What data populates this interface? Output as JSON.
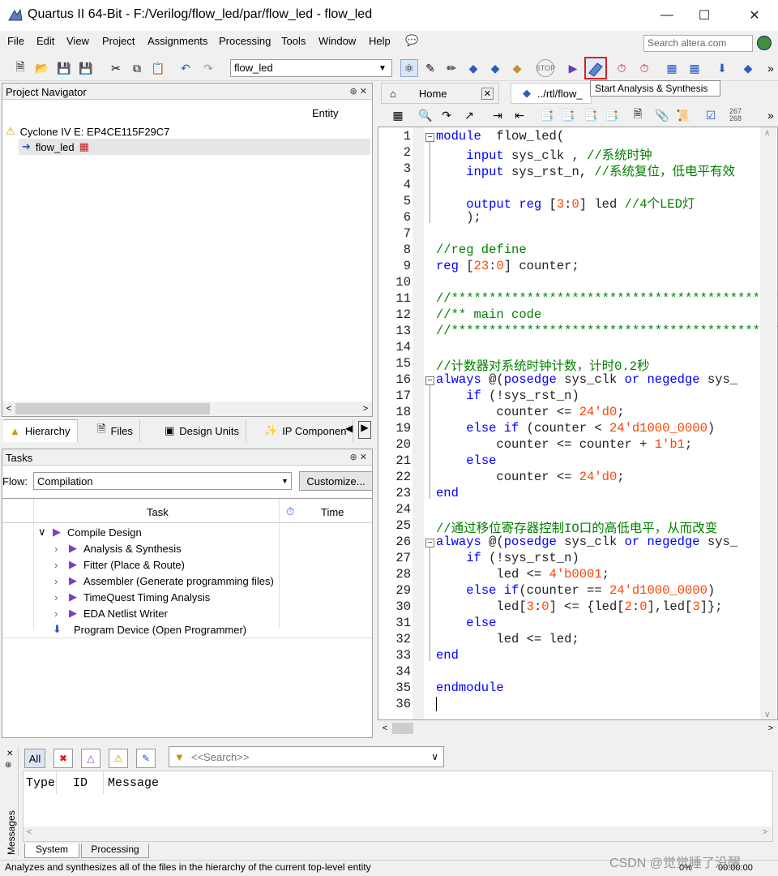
{
  "window": {
    "title": "Quartus II 64-Bit - F:/Verilog/flow_led/par/flow_led - flow_led"
  },
  "menu": [
    "File",
    "Edit",
    "View",
    "Project",
    "Assignments",
    "Processing",
    "Tools",
    "Window",
    "Help"
  ],
  "search": {
    "placeholder": "Search altera.com"
  },
  "toolbar": {
    "revision": "flow_led",
    "tooltip": "Start Analysis & Synthesis"
  },
  "navigator": {
    "title": "Project Navigator",
    "column": "Entity",
    "device": "Cyclone IV E: EP4CE115F29C7",
    "top_entity": "flow_led",
    "tabs": [
      "Hierarchy",
      "Files",
      "Design Units",
      "IP Componen"
    ]
  },
  "tasks": {
    "title": "Tasks",
    "flow_label": "Flow:",
    "flow_value": "Compilation",
    "customize": "Customize...",
    "col_task": "Task",
    "col_time": "Time",
    "items": [
      "Compile Design",
      "Analysis & Synthesis",
      "Fitter (Place & Route)",
      "Assembler (Generate programming files)",
      "TimeQuest Timing Analysis",
      "EDA Netlist Writer",
      "Program Device (Open Programmer)"
    ]
  },
  "editor": {
    "tabs": [
      "Home",
      "../rtl/flow_"
    ],
    "lines": [
      {
        "n": "1",
        "t": [
          [
            "kw",
            "module"
          ],
          [
            "",
            "  flow_led("
          ]
        ]
      },
      {
        "n": "2",
        "t": [
          [
            "",
            "    "
          ],
          [
            "kw",
            "input"
          ],
          [
            "",
            " sys_clk , "
          ],
          [
            "cm",
            "//系统时钟"
          ]
        ]
      },
      {
        "n": "3",
        "t": [
          [
            "",
            "    "
          ],
          [
            "kw",
            "input"
          ],
          [
            "",
            " sys_rst_n, "
          ],
          [
            "cm",
            "//系统复位，低电平有效"
          ]
        ]
      },
      {
        "n": "4",
        "t": []
      },
      {
        "n": "5",
        "t": [
          [
            "",
            "    "
          ],
          [
            "kw",
            "output reg"
          ],
          [
            "",
            " ["
          ],
          [
            "num",
            "3"
          ],
          [
            "",
            ":"
          ],
          [
            "num",
            "0"
          ],
          [
            "",
            "] led "
          ],
          [
            "cm",
            "//4个LED灯"
          ]
        ]
      },
      {
        "n": "6",
        "t": [
          [
            "",
            "    );"
          ]
        ]
      },
      {
        "n": "7",
        "t": []
      },
      {
        "n": "8",
        "t": [
          [
            "cm",
            "//reg define"
          ]
        ]
      },
      {
        "n": "9",
        "t": [
          [
            "kw",
            "reg"
          ],
          [
            "",
            " ["
          ],
          [
            "num",
            "23"
          ],
          [
            "",
            ":"
          ],
          [
            "num",
            "0"
          ],
          [
            "",
            "] counter;"
          ]
        ]
      },
      {
        "n": "10",
        "t": []
      },
      {
        "n": "11",
        "t": [
          [
            "cm",
            "//*****************************************************"
          ]
        ]
      },
      {
        "n": "12",
        "t": [
          [
            "cm",
            "//** main code"
          ]
        ]
      },
      {
        "n": "13",
        "t": [
          [
            "cm",
            "//*****************************************************"
          ]
        ]
      },
      {
        "n": "14",
        "t": []
      },
      {
        "n": "15",
        "t": [
          [
            "cm",
            "//计数器对系统时钟计数，计时0.2秒"
          ]
        ]
      },
      {
        "n": "16",
        "t": [
          [
            "kw",
            "always"
          ],
          [
            "",
            " @("
          ],
          [
            "kw",
            "posedge"
          ],
          [
            "",
            " sys_clk "
          ],
          [
            "kw",
            "or"
          ],
          [
            "",
            ""
          ],
          [
            "kw",
            " negedge"
          ],
          [
            "",
            " sys_"
          ]
        ]
      },
      {
        "n": "17",
        "t": [
          [
            "",
            "    "
          ],
          [
            "kw",
            "if"
          ],
          [
            "",
            " (!sys_rst_n)"
          ]
        ]
      },
      {
        "n": "18",
        "t": [
          [
            "",
            "        counter <= "
          ],
          [
            "num",
            "24'd0"
          ],
          [
            "",
            ";"
          ]
        ]
      },
      {
        "n": "19",
        "t": [
          [
            "",
            "    "
          ],
          [
            "kw",
            "else if"
          ],
          [
            "",
            " (counter < "
          ],
          [
            "num",
            "24'd1000_0000"
          ],
          [
            "",
            ")"
          ]
        ]
      },
      {
        "n": "20",
        "t": [
          [
            "",
            "        counter <= counter + "
          ],
          [
            "num",
            "1'b1"
          ],
          [
            "",
            ";"
          ]
        ]
      },
      {
        "n": "21",
        "t": [
          [
            "",
            "    "
          ],
          [
            "kw",
            "else"
          ]
        ]
      },
      {
        "n": "22",
        "t": [
          [
            "",
            "        counter <= "
          ],
          [
            "num",
            "24'd0"
          ],
          [
            "",
            ";"
          ]
        ]
      },
      {
        "n": "23",
        "t": [
          [
            "kw",
            "end"
          ]
        ]
      },
      {
        "n": "24",
        "t": []
      },
      {
        "n": "25",
        "t": [
          [
            "cm",
            "//通过移位寄存器控制IO口的高低电平，从而改变"
          ]
        ]
      },
      {
        "n": "26",
        "t": [
          [
            "kw",
            "always"
          ],
          [
            "",
            " @("
          ],
          [
            "kw",
            "posedge"
          ],
          [
            "",
            " sys_clk "
          ],
          [
            "kw",
            "or"
          ],
          [
            "kw",
            " negedge"
          ],
          [
            "",
            " sys_"
          ]
        ]
      },
      {
        "n": "27",
        "t": [
          [
            "",
            "    "
          ],
          [
            "kw",
            "if"
          ],
          [
            "",
            " (!sys_rst_n)"
          ]
        ]
      },
      {
        "n": "28",
        "t": [
          [
            "",
            "        led <= "
          ],
          [
            "num",
            "4'b0001"
          ],
          [
            "",
            ";"
          ]
        ]
      },
      {
        "n": "29",
        "t": [
          [
            "",
            "    "
          ],
          [
            "kw",
            "else if"
          ],
          [
            "",
            "(counter == "
          ],
          [
            "num",
            "24'd1000_0000"
          ],
          [
            "",
            ")"
          ]
        ]
      },
      {
        "n": "30",
        "t": [
          [
            "",
            "        led["
          ],
          [
            "num",
            "3"
          ],
          [
            "",
            ":"
          ],
          [
            "num",
            "0"
          ],
          [
            "",
            "] <= {led["
          ],
          [
            "num",
            "2"
          ],
          [
            "",
            ":"
          ],
          [
            "num",
            "0"
          ],
          [
            "",
            "],led["
          ],
          [
            "num",
            "3"
          ],
          [
            "",
            "]};"
          ]
        ]
      },
      {
        "n": "31",
        "t": [
          [
            "",
            "    "
          ],
          [
            "kw",
            "else"
          ]
        ]
      },
      {
        "n": "32",
        "t": [
          [
            "",
            "        led <= led;"
          ]
        ]
      },
      {
        "n": "33",
        "t": [
          [
            "kw",
            "end"
          ]
        ]
      },
      {
        "n": "34",
        "t": []
      },
      {
        "n": "35",
        "t": [
          [
            "kw",
            "endmodule"
          ]
        ]
      },
      {
        "n": "36",
        "t": []
      }
    ]
  },
  "messages": {
    "all": "All",
    "search_placeholder": "<<Search>>",
    "col_type": "Type",
    "col_id": "ID",
    "col_message": "Message",
    "side_label": "Messages",
    "tabs": [
      "System",
      "Processing"
    ]
  },
  "status": {
    "text": "Analyzes and synthesizes all of the files in the hierarchy of the current top-level entity",
    "percent": "0%",
    "time": "00:00:00",
    "watermark": "CSDN @觉觉睡了没醒"
  }
}
